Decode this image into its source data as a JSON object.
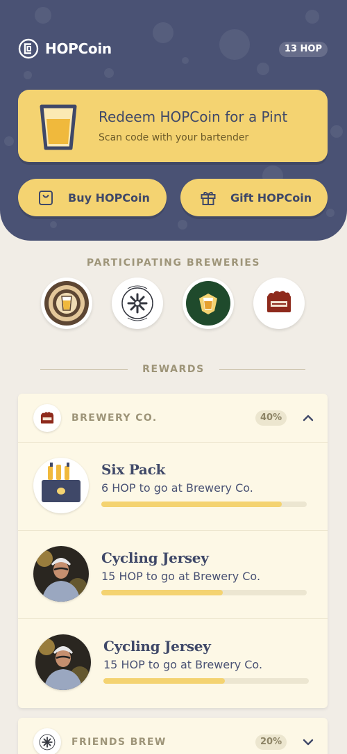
{
  "app": {
    "name": "HOPCoin",
    "balance": "13 HOP",
    "logo_icon": "hopcoin-logo-icon"
  },
  "redeem": {
    "title": "Redeem HOPCoin for a Pint",
    "subtitle": "Scan code with your bartender",
    "icon": "pint-glass-icon"
  },
  "actions": [
    {
      "label": "Buy HOPCoin",
      "icon": "shopping-bag-icon"
    },
    {
      "label": "Gift HOPCoin",
      "icon": "gift-icon"
    }
  ],
  "breweries": {
    "heading": "PARTICIPATING BREWERIES",
    "logos": [
      "brown-pint-brewery-logo",
      "brewing-company-snowflake-logo",
      "green-pint-brewery-logo",
      "brewers-crate-logo"
    ]
  },
  "rewards": {
    "heading": "REWARDS",
    "groups": [
      {
        "name": "BREWERY CO.",
        "percent": "40%",
        "progress": 0.4,
        "expanded": true,
        "items": [
          {
            "name": "Six Pack",
            "detail": "6 HOP to go at Brewery Co.",
            "progress": 0.88,
            "image": "six-pack-image"
          },
          {
            "name": "Cycling Jersey",
            "detail": "15 HOP to go at Brewery Co.",
            "progress": 0.59,
            "image": "cyclist-photo"
          },
          {
            "name": "Cycling Jersey",
            "detail": "15 HOP to go at Brewery Co.",
            "progress": 0.59,
            "image": "cyclist-photo"
          }
        ]
      },
      {
        "name": "FRIENDS BREW",
        "percent": "20%",
        "progress": 0.2,
        "expanded": false
      }
    ]
  },
  "colors": {
    "navy": "#4a5274",
    "yellow": "#f4d371",
    "cream": "#fdf8e6",
    "background": "#f1ede6"
  }
}
